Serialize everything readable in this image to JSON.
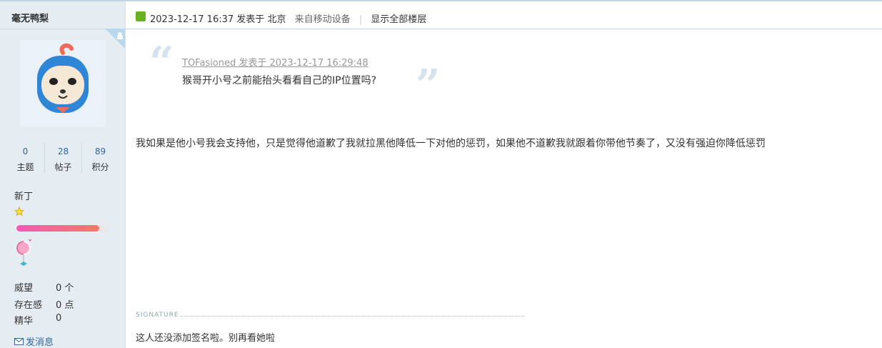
{
  "author": {
    "name": "毫无鸭梨",
    "stats": [
      {
        "value": "0",
        "label": "主题"
      },
      {
        "value": "28",
        "label": "帖子"
      },
      {
        "value": "89",
        "label": "积分"
      }
    ],
    "rank": "新丁",
    "level_progress": 0.89,
    "props": [
      {
        "label": "威望",
        "value": "0 个"
      },
      {
        "label": "存在感",
        "value": "0 点"
      },
      {
        "label": "精华",
        "value": "0"
      }
    ],
    "pm_label": "发消息"
  },
  "post": {
    "datetime": "2023-12-17 16:37",
    "posted_at_label": "发表于",
    "location": "北京",
    "device": "来自移动设备",
    "show_all": "显示全部楼层",
    "quote_author": "TOFasioned 发表于 2023-12-17 16:29:48",
    "quote_text": "猴哥开小号之前能抬头看看自己的IP位置吗?",
    "body": "我如果是他小号我会支持他，只是觉得他道歉了我就拉黑他降低一下对他的惩罚，如果他不道歉我就跟着你带他节奏了，又没有强迫你降低惩罚",
    "signature_label": "SIGNATURE",
    "signature": "这人还没添加签名啦。别再看她啦"
  },
  "colors": {
    "link": "#336699",
    "accent": "#6ab024",
    "sidebar_bg": "#e5edf2"
  }
}
